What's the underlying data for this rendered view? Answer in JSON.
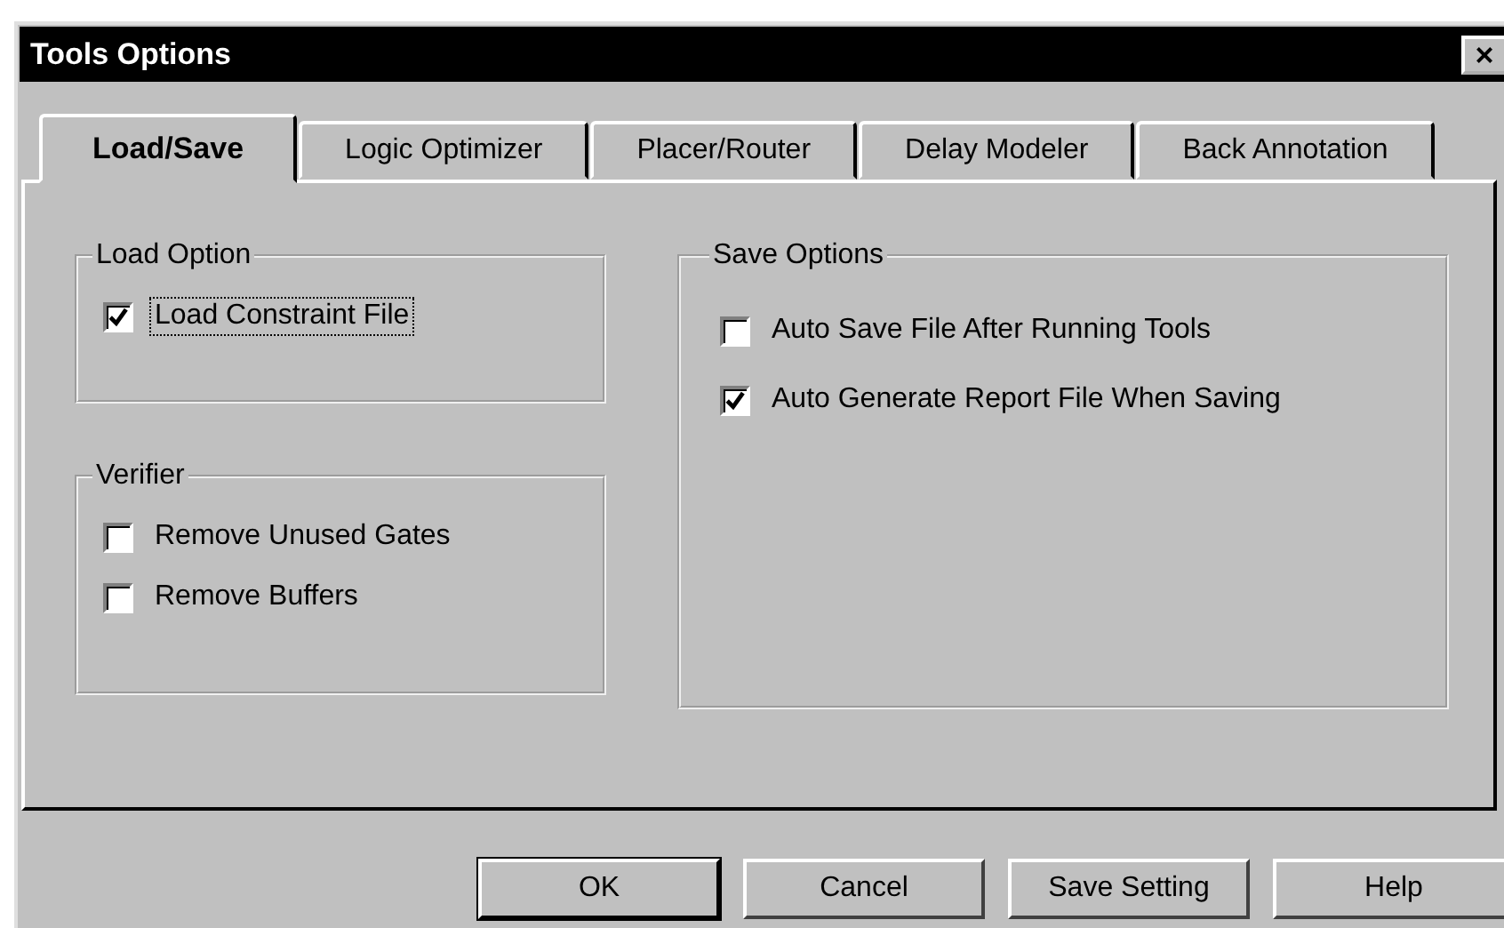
{
  "window": {
    "title": "Tools Options",
    "close_label": "×"
  },
  "tabs": [
    {
      "label": "Load/Save",
      "selected": true
    },
    {
      "label": "Logic Optimizer",
      "selected": false
    },
    {
      "label": "Placer/Router",
      "selected": false
    },
    {
      "label": "Delay Modeler",
      "selected": false
    },
    {
      "label": "Back Annotation",
      "selected": false
    }
  ],
  "left_groups": [
    {
      "title": "Load Option",
      "options": [
        {
          "label": "Load Constraint File",
          "checked": true,
          "focused": true
        }
      ]
    },
    {
      "title": "Verifier",
      "options": [
        {
          "label": "Remove Unused Gates",
          "checked": false,
          "focused": false
        },
        {
          "label": "Remove Buffers",
          "checked": false,
          "focused": false
        }
      ]
    }
  ],
  "right_group": {
    "title": "Save Options",
    "options": [
      {
        "label": "Auto Save File After Running Tools",
        "checked": false,
        "focused": false
      },
      {
        "label": "Auto Generate Report File When Saving",
        "checked": true,
        "focused": false
      }
    ]
  },
  "buttons": [
    {
      "label": "OK",
      "default": true
    },
    {
      "label": "Cancel",
      "default": false
    },
    {
      "label": "Save Setting",
      "default": false
    },
    {
      "label": "Help",
      "default": false
    }
  ]
}
